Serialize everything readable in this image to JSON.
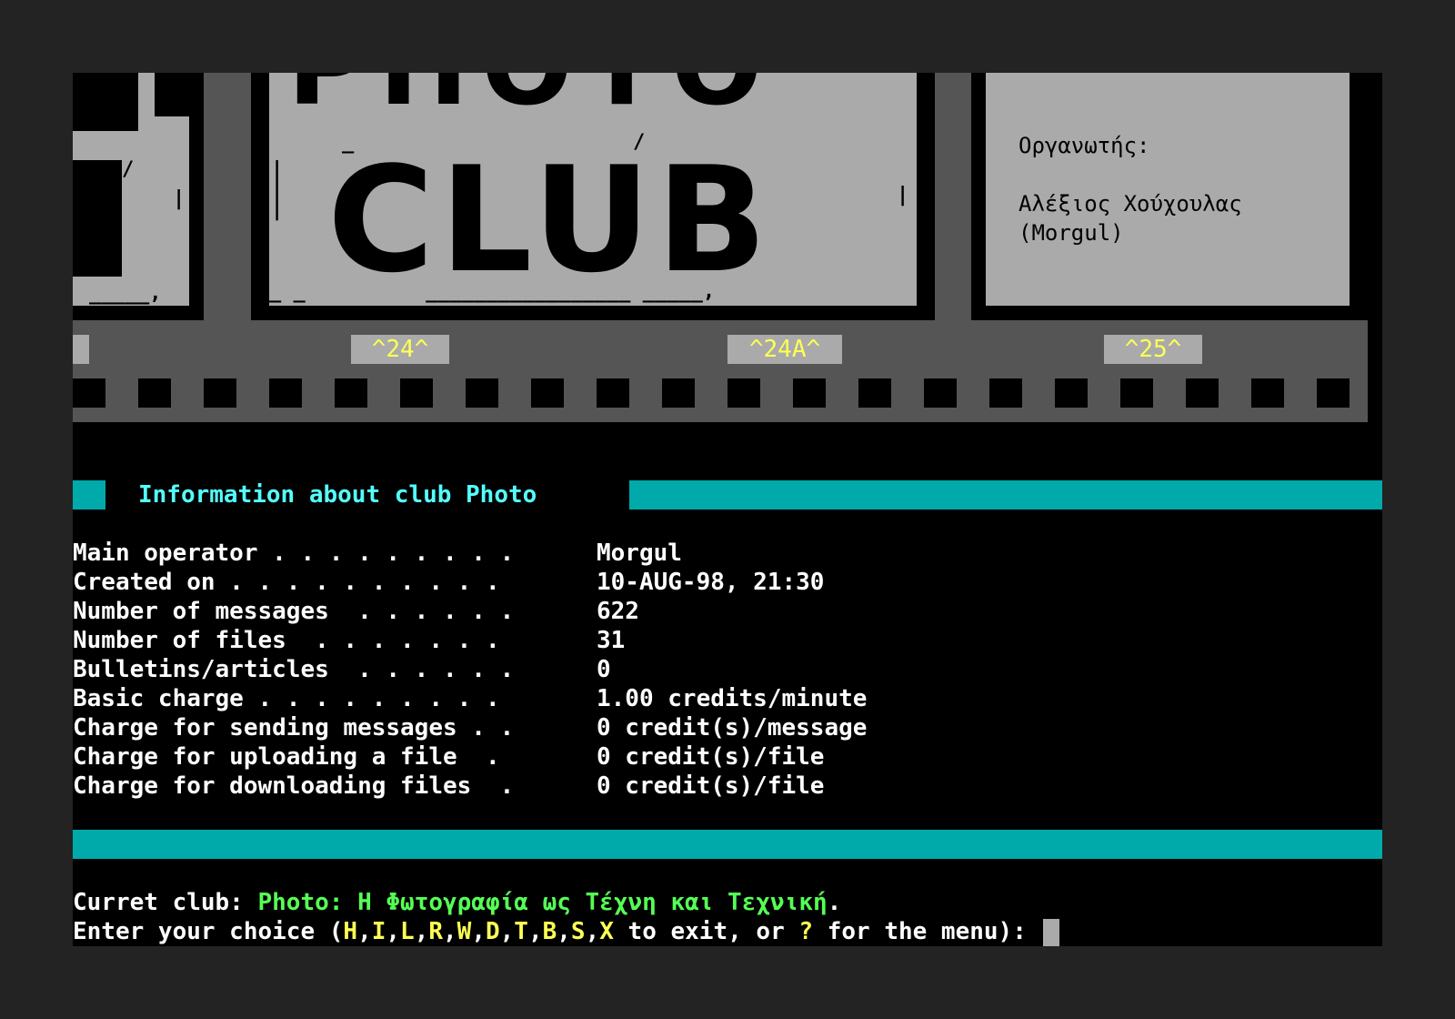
{
  "banner": {
    "big_top": "PHOTO",
    "big_main": "CLUB",
    "organizer_label": "Οργανωτής:",
    "organizer_name": "Αλέξιος Χούχουλας",
    "organizer_nick": "(Morgul)",
    "frame_numbers": [
      "^24^",
      "^24A^",
      "^25^"
    ]
  },
  "info": {
    "title": "Information about club Photo",
    "rows": [
      {
        "label": "Main operator . . . . . . . . .",
        "value": "Morgul"
      },
      {
        "label": "Created on . . . . . . . . . .",
        "value": "10-AUG-98, 21:30"
      },
      {
        "label": "Number of messages  . . . . . .",
        "value": "622"
      },
      {
        "label": "Number of files  . . . . . . .",
        "value": "31"
      },
      {
        "label": "Bulletins/articles  . . . . . .",
        "value": "0"
      },
      {
        "label": "Basic charge . . . . . . . . .",
        "value": "1.00 credits/minute"
      },
      {
        "label": "Charge for sending messages . .",
        "value": "0 credit(s)/message"
      },
      {
        "label": "Charge for uploading a file  .",
        "value": "0 credit(s)/file"
      },
      {
        "label": "Charge for downloading files  .",
        "value": "0 credit(s)/file"
      }
    ]
  },
  "status": {
    "current_label": "Curret club: ",
    "current_club": "Photo: Η Φωτογραφία ως Τέχνη και Τεχνική",
    "period": ".",
    "prompt_start": "Enter your choice (",
    "choices": [
      "H",
      "I",
      "L",
      "R",
      "W",
      "D",
      "T",
      "B",
      "S",
      "X"
    ],
    "to_exit": " to exit, or ",
    "help_key": "?",
    "prompt_end": " for the menu): "
  },
  "colors": {
    "teal": "#00aaaa",
    "light_cyan": "#55ffff",
    "yellow": "#ffff55",
    "green": "#55ff55",
    "gray": "#aaaaaa",
    "dark_gray": "#555555"
  }
}
